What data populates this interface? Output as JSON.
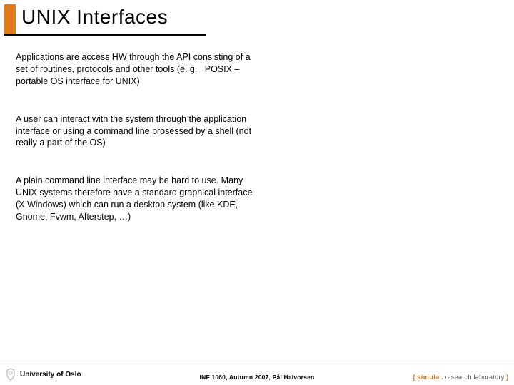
{
  "title": "UNIX Interfaces",
  "paragraphs": {
    "p1": "Applications are access HW through the API consisting of a set of routines, protocols and other tools (e. g. , POSIX – portable OS interface for UNIX)",
    "p2": "A user can interact with the system through the application interface or using a command line prosessed by a shell (not really a part of the OS)",
    "p3": "A plain command line interface may be hard to use. Many UNIX systems therefore have a standard graphical interface (X Windows) which can run a desktop system (like KDE, Gnome, Fvwm, Afterstep, …)"
  },
  "footer": {
    "university": "University of Oslo",
    "course": "INF 1060, Autumn 2007, Pål Halvorsen",
    "lab_prefix": "[ ",
    "lab_name": "simula",
    "lab_dot": " . ",
    "lab_suffix": "research laboratory",
    "lab_close": " ]"
  }
}
